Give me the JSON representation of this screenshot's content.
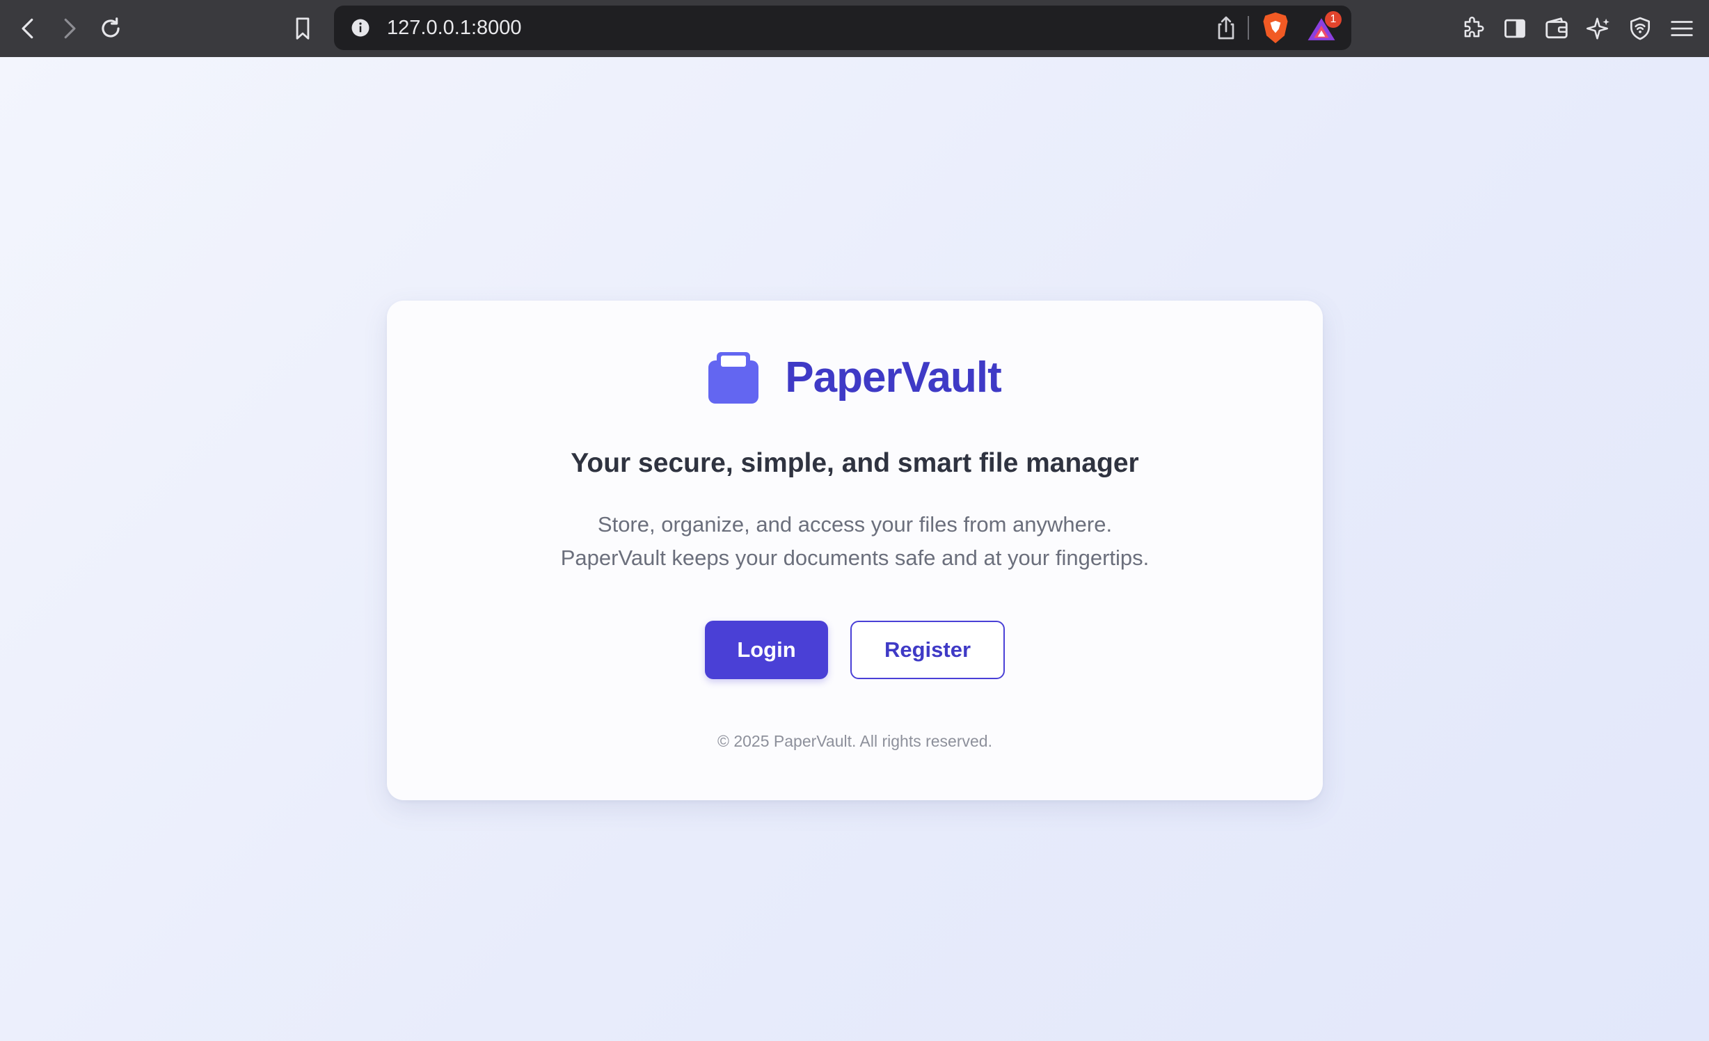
{
  "browser": {
    "url": "127.0.0.1:8000",
    "rewards_badge": "1"
  },
  "app": {
    "brand_name": "PaperVault",
    "headline": "Your secure, simple, and smart file manager",
    "description_line1": "Store, organize, and access your files from anywhere.",
    "description_line2": "PaperVault keeps your documents safe and at your fingertips.",
    "login_label": "Login",
    "register_label": "Register",
    "footer": "© 2025 PaperVault. All rights reserved."
  },
  "icons": {
    "toolbar": [
      "back-icon",
      "forward-icon",
      "reload-icon",
      "bookmark-icon",
      "site-info-icon",
      "share-icon",
      "brave-shields-icon",
      "brave-rewards-icon",
      "extensions-icon",
      "sidebar-icon",
      "wallet-icon",
      "leo-ai-icon",
      "vpn-icon",
      "menu-icon"
    ],
    "brand": "folder-logo-icon"
  },
  "colors": {
    "brand": "#3f3ac6",
    "primary_button": "#4a40d6",
    "logo": "#6366f1",
    "toolbar": "#3a3a3e"
  }
}
